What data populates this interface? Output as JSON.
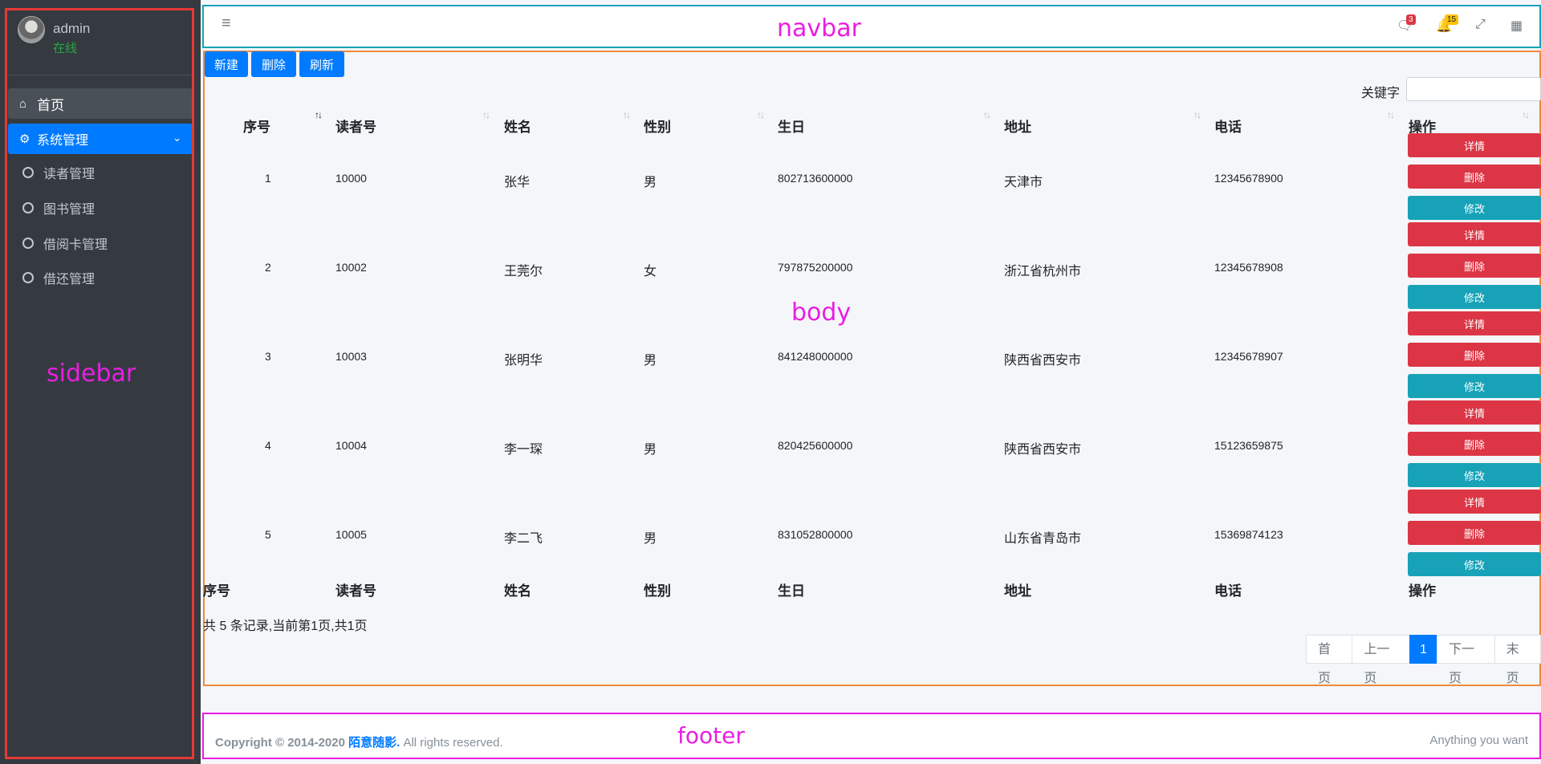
{
  "sidebar": {
    "user": {
      "name": "admin",
      "status": "在线"
    },
    "home": {
      "icon": "home-icon",
      "label": "首页"
    },
    "system": {
      "icon": "gear-icon",
      "label": "系统管理"
    },
    "items": [
      {
        "label": "读者管理"
      },
      {
        "label": "图书管理"
      },
      {
        "label": "借阅卡管理"
      },
      {
        "label": "借还管理"
      }
    ]
  },
  "annotations": {
    "sidebar": "sidebar",
    "navbar": "navbar",
    "body": "body",
    "footer": "footer"
  },
  "navbar": {
    "icons": [
      "menu-icon",
      "comments-icon",
      "bell-icon",
      "expand-icon",
      "grid-icon"
    ],
    "messages_count": "3",
    "notifications_count": "15"
  },
  "toolbar": {
    "new": "新建",
    "delete": "删除",
    "refresh": "刷新"
  },
  "search": {
    "label": "关键字",
    "value": ""
  },
  "table": {
    "headers": [
      "序号",
      "读者号",
      "姓名",
      "性别",
      "生日",
      "地址",
      "电话",
      "操作"
    ],
    "rows": [
      [
        "1",
        "10000",
        "张华",
        "男",
        "802713600000",
        "天津市",
        "12345678900"
      ],
      [
        "2",
        "10002",
        "王莞尔",
        "女",
        "797875200000",
        "浙江省杭州市",
        "12345678908"
      ],
      [
        "3",
        "10003",
        "张明华",
        "男",
        "841248000000",
        "陕西省西安市",
        "12345678907"
      ],
      [
        "4",
        "10004",
        "李一琛",
        "男",
        "820425600000",
        "陕西省西安市",
        "15123659875"
      ],
      [
        "5",
        "10005",
        "李二飞",
        "男",
        "831052800000",
        "山东省青岛市",
        "15369874123"
      ]
    ],
    "actions": {
      "detail": "详情",
      "delete": "删除",
      "edit": "修改"
    },
    "info": "共 5 条记录,当前第1页,共1页"
  },
  "pagination": {
    "first": "首页",
    "prev": "上一页",
    "current": "1",
    "next": "下一页",
    "last": "末页"
  },
  "footer": {
    "prefix": "Copyright © 2014-2020 ",
    "brand": "陌意随影.",
    "suffix": " All rights reserved.",
    "right": "Anything you want"
  },
  "colors": {
    "primary": "#007bff",
    "danger": "#dc3545",
    "info": "#17a2b8",
    "sidebar": "#343a40"
  }
}
